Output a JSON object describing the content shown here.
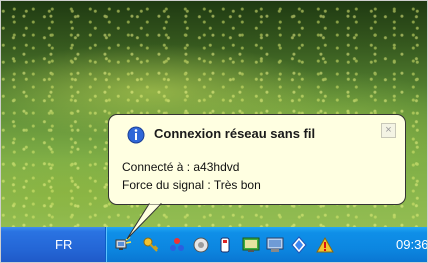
{
  "notification": {
    "title": "Connexion réseau sans fil",
    "close_symbol": "×",
    "connected_line": "Connecté à : a43hdvd",
    "signal_line": "Force du signal : Très bon",
    "icon": "info-icon"
  },
  "taskbar": {
    "language": "FR",
    "clock": "09:36",
    "tray_icons": [
      "wireless-network-icon",
      "key-icon",
      "users-icon",
      "speaker-icon",
      "usb-device-icon",
      "display-icon",
      "monitor-icon",
      "shield-icon",
      "security-warning-icon"
    ]
  },
  "colors": {
    "balloon_bg": "#ffffe1",
    "taskbar_blue": "#2466d6",
    "tray_blue": "#0c86e0"
  }
}
